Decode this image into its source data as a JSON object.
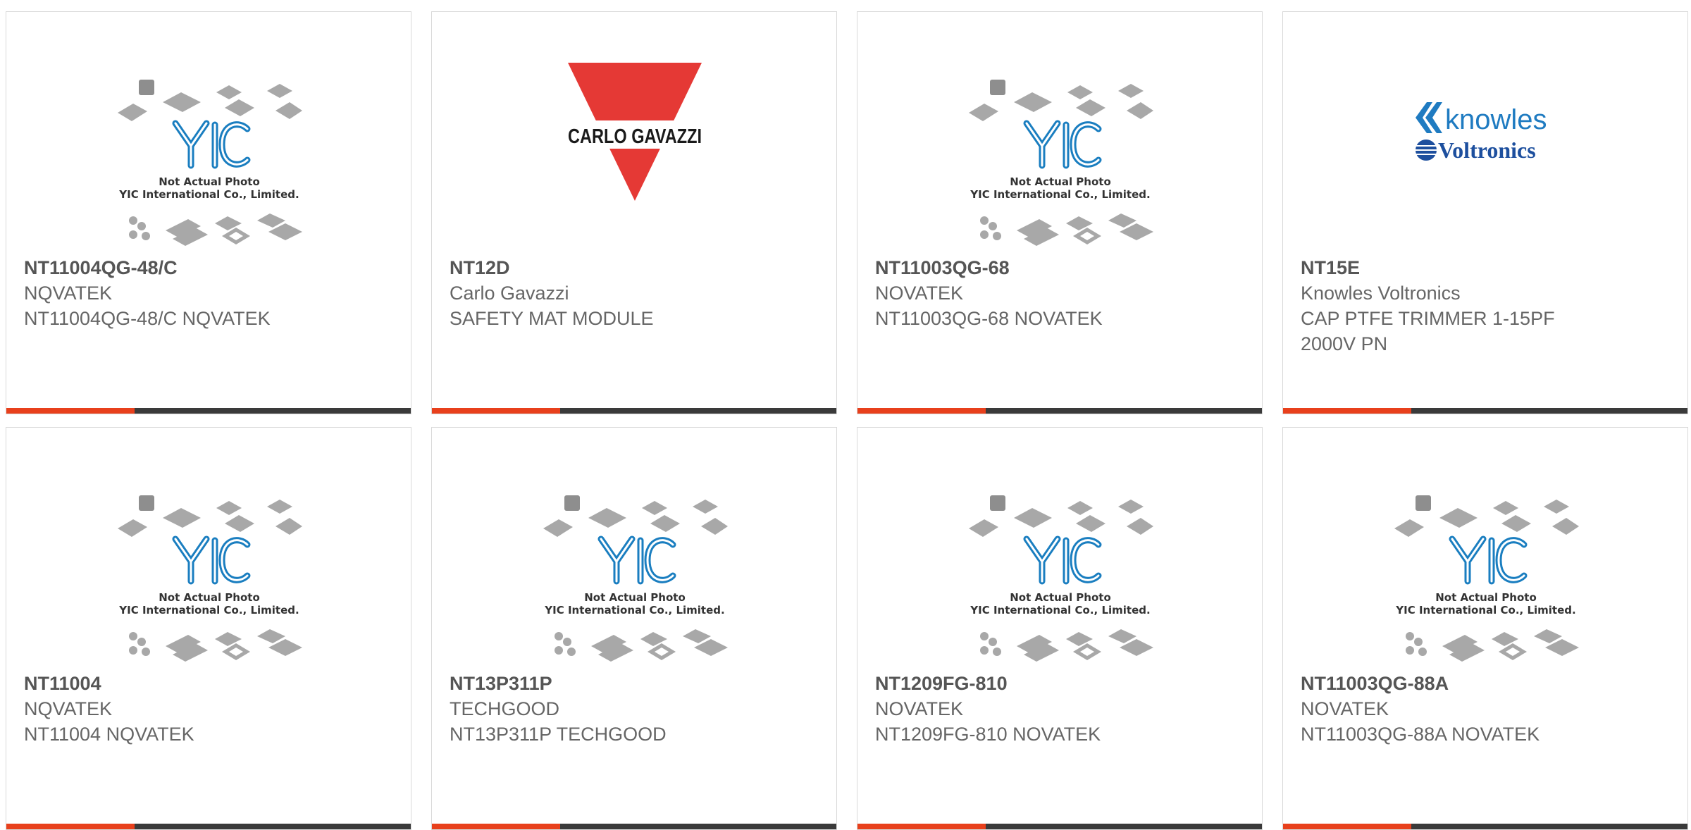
{
  "placeholder": {
    "line1": "Not Actual Photo",
    "line2": "YIC International Co., Limited.",
    "logo_text": "YIC"
  },
  "logos": {
    "carlo_gavazzi": "CARLO GAVAZZI",
    "knowles_top": "knowles",
    "knowles_bottom": "Voltronics"
  },
  "colors": {
    "accent": "#e8401c",
    "bar": "#3a3a3a",
    "yic_blue": "#1a7ec0",
    "carlo_red": "#e53935",
    "knowles_blue": "#1f7bc1",
    "voltronics_blue": "#1d4f9e"
  },
  "products": [
    {
      "part": "NT11004QG-48/C",
      "manufacturer": "NQVATEK",
      "description": "NT11004QG-48/C NQVATEK",
      "image": "yic-placeholder"
    },
    {
      "part": "NT12D",
      "manufacturer": "Carlo Gavazzi",
      "description": "SAFETY MAT MODULE",
      "image": "carlo-gavazzi-logo"
    },
    {
      "part": "NT11003QG-68",
      "manufacturer": "NOVATEK",
      "description": "NT11003QG-68 NOVATEK",
      "image": "yic-placeholder"
    },
    {
      "part": "NT15E",
      "manufacturer": "Knowles Voltronics",
      "description": "CAP PTFE TRIMMER 1-15PF 2000V PN",
      "image": "knowles-voltronics-logo"
    },
    {
      "part": "NT11004",
      "manufacturer": "NQVATEK",
      "description": "NT11004 NQVATEK",
      "image": "yic-placeholder"
    },
    {
      "part": "NT13P311P",
      "manufacturer": "TECHGOOD",
      "description": "NT13P311P TECHGOOD",
      "image": "yic-placeholder"
    },
    {
      "part": "NT1209FG-810",
      "manufacturer": "NOVATEK",
      "description": "NT1209FG-810 NOVATEK",
      "image": "yic-placeholder"
    },
    {
      "part": "NT11003QG-88A",
      "manufacturer": "NOVATEK",
      "description": "NT11003QG-88A NOVATEK",
      "image": "yic-placeholder"
    }
  ]
}
